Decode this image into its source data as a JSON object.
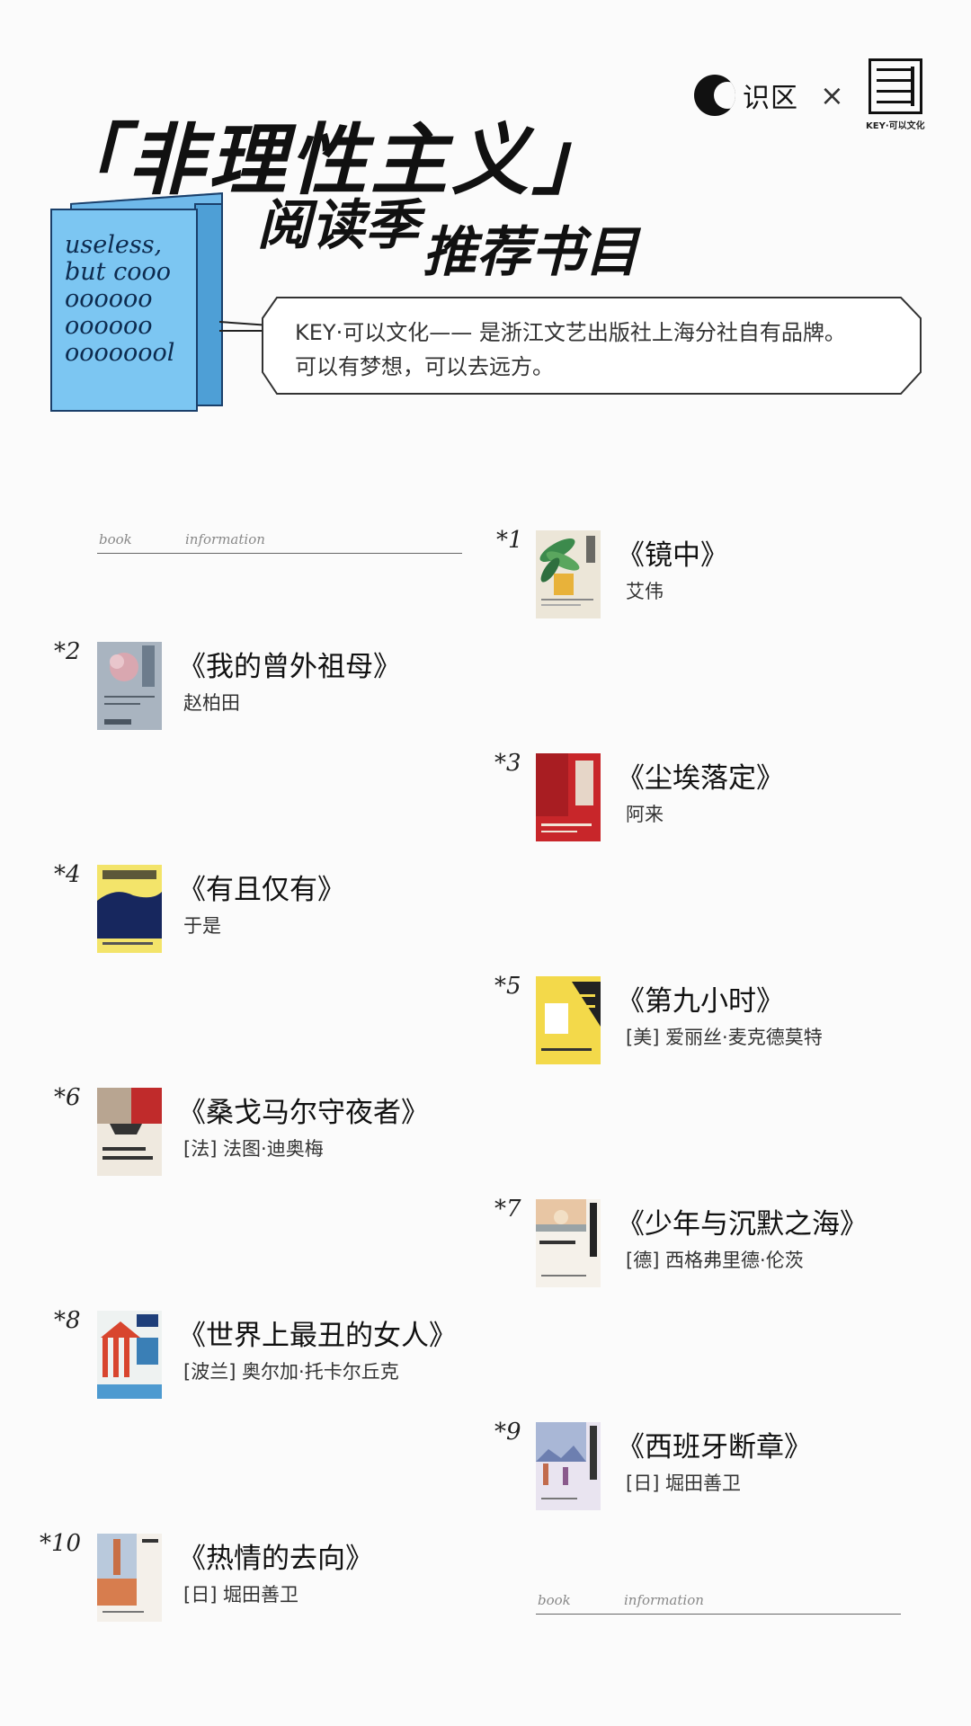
{
  "header": {
    "partner1": "识区",
    "cross": "×",
    "partner2_caption": "KEY·可以文化",
    "title": "「非理性主义」",
    "subtitle1": "阅读季",
    "subtitle2": "推荐书目",
    "book_art_text": "useless,\nbut cooo\noooooo\noooooo\noooooool",
    "intro_line1": "KEY·可以文化—— 是浙江文艺出版社上海分社自有品牌。",
    "intro_line2": "可以有梦想，可以去远方。"
  },
  "info_label": {
    "word1": "book",
    "word2": "information"
  },
  "books": [
    {
      "num": "*1",
      "title": "《镜中》",
      "author": "艾伟"
    },
    {
      "num": "*2",
      "title": "《我的曾外祖母》",
      "author": "赵柏田"
    },
    {
      "num": "*3",
      "title": "《尘埃落定》",
      "author": "阿来"
    },
    {
      "num": "*4",
      "title": "《有且仅有》",
      "author": "于是"
    },
    {
      "num": "*5",
      "title": "《第九小时》",
      "author": "[美] 爱丽丝·麦克德莫特"
    },
    {
      "num": "*6",
      "title": "《桑戈马尔守夜者》",
      "author": "[法] 法图·迪奥梅"
    },
    {
      "num": "*7",
      "title": "《少年与沉默之海》",
      "author": "[德] 西格弗里德·伦茨"
    },
    {
      "num": "*8",
      "title": "《世界上最丑的女人》",
      "author": "[波兰] 奥尔加·托卡尔丘克"
    },
    {
      "num": "*9",
      "title": "《西班牙断章》",
      "author": "[日] 堀田善卫"
    },
    {
      "num": "*10",
      "title": "《热情的去向》",
      "author": "[日] 堀田善卫"
    }
  ],
  "colors": {
    "blue_book": "#7cc6f2",
    "ink": "#111111"
  }
}
